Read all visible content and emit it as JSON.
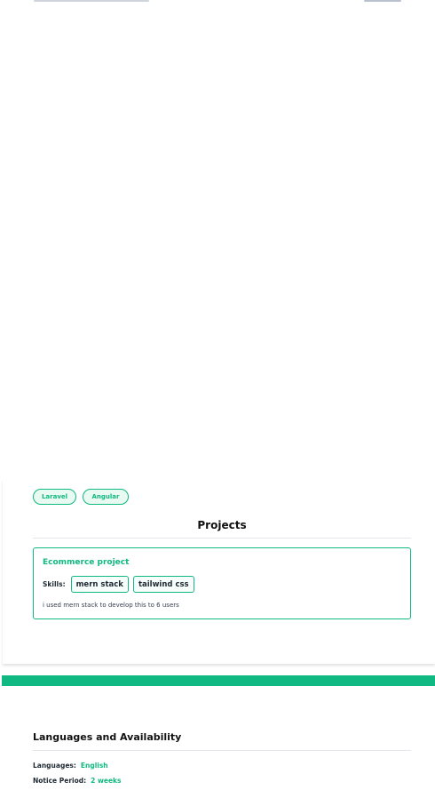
{
  "skills_chips": [
    "Laravel",
    "Angular"
  ],
  "projects": {
    "title": "Projects",
    "items": [
      {
        "name": "Ecommerce project",
        "skills_label": "Skills:",
        "skills": [
          "mern stack",
          "tailwind css"
        ],
        "description": "i used mern stack to develop this to 6 users"
      }
    ]
  },
  "languages": {
    "title": "Languages and Availability",
    "languages_label": "Languages:",
    "languages_value": "English",
    "notice_label": "Notice Period:",
    "notice_value": "2 weeks"
  },
  "colors": {
    "accent": "#10b981"
  }
}
